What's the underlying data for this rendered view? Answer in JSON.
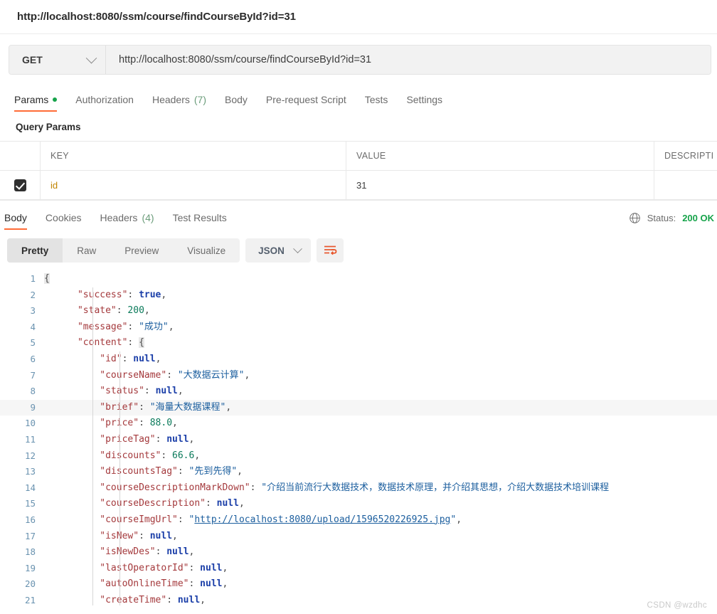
{
  "request": {
    "title": "http://localhost:8080/ssm/course/findCourseById?id=31",
    "method": "GET",
    "url": "http://localhost:8080/ssm/course/findCourseById?id=31",
    "tabs": [
      {
        "label": "Params",
        "badge": "",
        "dot": true,
        "active": true
      },
      {
        "label": "Authorization",
        "badge": "",
        "dot": false,
        "active": false
      },
      {
        "label": "Headers",
        "badge": "(7)",
        "dot": false,
        "active": false
      },
      {
        "label": "Body",
        "badge": "",
        "dot": false,
        "active": false
      },
      {
        "label": "Pre-request Script",
        "badge": "",
        "dot": false,
        "active": false
      },
      {
        "label": "Tests",
        "badge": "",
        "dot": false,
        "active": false
      },
      {
        "label": "Settings",
        "badge": "",
        "dot": false,
        "active": false
      }
    ]
  },
  "params": {
    "section_label": "Query Params",
    "columns": [
      "KEY",
      "VALUE",
      "DESCRIPTI"
    ],
    "rows": [
      {
        "checked": true,
        "key": "id",
        "value": "31",
        "description": ""
      }
    ]
  },
  "response": {
    "tabs": [
      {
        "label": "Body",
        "badge": "",
        "active": true
      },
      {
        "label": "Cookies",
        "badge": "",
        "active": false
      },
      {
        "label": "Headers",
        "badge": "(4)",
        "active": false
      },
      {
        "label": "Test Results",
        "badge": "",
        "active": false
      }
    ],
    "status_label": "Status:",
    "status_code": "200 OK",
    "globe_icon": "globe-icon"
  },
  "viewer": {
    "modes": [
      "Pretty",
      "Raw",
      "Preview",
      "Visualize"
    ],
    "active_mode": "Pretty",
    "format": "JSON",
    "wrap_icon": "wrap-text-icon"
  },
  "code": {
    "lines": [
      {
        "num": "1",
        "indent": 0,
        "highlight": false,
        "tokens": [
          {
            "t": "brc",
            "v": "{"
          }
        ]
      },
      {
        "num": "2",
        "indent": 1,
        "highlight": false,
        "tokens": [
          {
            "t": "k",
            "v": "\"success\""
          },
          {
            "t": "p",
            "v": ": "
          },
          {
            "t": "b",
            "v": "true"
          },
          {
            "t": "p",
            "v": ","
          }
        ]
      },
      {
        "num": "3",
        "indent": 1,
        "highlight": false,
        "tokens": [
          {
            "t": "k",
            "v": "\"state\""
          },
          {
            "t": "p",
            "v": ": "
          },
          {
            "t": "n",
            "v": "200"
          },
          {
            "t": "p",
            "v": ","
          }
        ]
      },
      {
        "num": "4",
        "indent": 1,
        "highlight": false,
        "tokens": [
          {
            "t": "k",
            "v": "\"message\""
          },
          {
            "t": "p",
            "v": ": "
          },
          {
            "t": "s",
            "v": "\"成功\""
          },
          {
            "t": "p",
            "v": ","
          }
        ]
      },
      {
        "num": "5",
        "indent": 1,
        "highlight": false,
        "tokens": [
          {
            "t": "k",
            "v": "\"content\""
          },
          {
            "t": "p",
            "v": ": "
          },
          {
            "t": "brc",
            "v": "{"
          }
        ]
      },
      {
        "num": "6",
        "indent": 2,
        "highlight": false,
        "tokens": [
          {
            "t": "k",
            "v": "\"id\""
          },
          {
            "t": "p",
            "v": ": "
          },
          {
            "t": "b",
            "v": "null"
          },
          {
            "t": "p",
            "v": ","
          }
        ]
      },
      {
        "num": "7",
        "indent": 2,
        "highlight": false,
        "tokens": [
          {
            "t": "k",
            "v": "\"courseName\""
          },
          {
            "t": "p",
            "v": ": "
          },
          {
            "t": "s",
            "v": "\"大数据云计算\""
          },
          {
            "t": "p",
            "v": ","
          }
        ]
      },
      {
        "num": "8",
        "indent": 2,
        "highlight": false,
        "tokens": [
          {
            "t": "k",
            "v": "\"status\""
          },
          {
            "t": "p",
            "v": ": "
          },
          {
            "t": "b",
            "v": "null"
          },
          {
            "t": "p",
            "v": ","
          }
        ]
      },
      {
        "num": "9",
        "indent": 2,
        "highlight": true,
        "tokens": [
          {
            "t": "k",
            "v": "\"brief\""
          },
          {
            "t": "p",
            "v": ": "
          },
          {
            "t": "s",
            "v": "\"海量大数据课程\""
          },
          {
            "t": "p",
            "v": ","
          }
        ]
      },
      {
        "num": "10",
        "indent": 2,
        "highlight": false,
        "tokens": [
          {
            "t": "k",
            "v": "\"price\""
          },
          {
            "t": "p",
            "v": ": "
          },
          {
            "t": "n",
            "v": "88.0"
          },
          {
            "t": "p",
            "v": ","
          }
        ]
      },
      {
        "num": "11",
        "indent": 2,
        "highlight": false,
        "tokens": [
          {
            "t": "k",
            "v": "\"priceTag\""
          },
          {
            "t": "p",
            "v": ": "
          },
          {
            "t": "b",
            "v": "null"
          },
          {
            "t": "p",
            "v": ","
          }
        ]
      },
      {
        "num": "12",
        "indent": 2,
        "highlight": false,
        "tokens": [
          {
            "t": "k",
            "v": "\"discounts\""
          },
          {
            "t": "p",
            "v": ": "
          },
          {
            "t": "n",
            "v": "66.6"
          },
          {
            "t": "p",
            "v": ","
          }
        ]
      },
      {
        "num": "13",
        "indent": 2,
        "highlight": false,
        "tokens": [
          {
            "t": "k",
            "v": "\"discountsTag\""
          },
          {
            "t": "p",
            "v": ": "
          },
          {
            "t": "s",
            "v": "\"先到先得\""
          },
          {
            "t": "p",
            "v": ","
          }
        ]
      },
      {
        "num": "14",
        "indent": 2,
        "highlight": false,
        "tokens": [
          {
            "t": "k",
            "v": "\"courseDescriptionMarkDown\""
          },
          {
            "t": "p",
            "v": ": "
          },
          {
            "t": "s",
            "v": "\"介绍当前流行大数据技术，数据技术原理，并介绍其思想，介绍大数据技术培训课程"
          }
        ]
      },
      {
        "num": "15",
        "indent": 2,
        "highlight": false,
        "tokens": [
          {
            "t": "k",
            "v": "\"courseDescription\""
          },
          {
            "t": "p",
            "v": ": "
          },
          {
            "t": "b",
            "v": "null"
          },
          {
            "t": "p",
            "v": ","
          }
        ]
      },
      {
        "num": "16",
        "indent": 2,
        "highlight": false,
        "tokens": [
          {
            "t": "k",
            "v": "\"courseImgUrl\""
          },
          {
            "t": "p",
            "v": ": "
          },
          {
            "t": "s",
            "v": "\""
          },
          {
            "t": "lnk",
            "v": "http://localhost:8080/upload/1596520226925.jpg"
          },
          {
            "t": "s",
            "v": "\""
          },
          {
            "t": "p",
            "v": ","
          }
        ]
      },
      {
        "num": "17",
        "indent": 2,
        "highlight": false,
        "tokens": [
          {
            "t": "k",
            "v": "\"isNew\""
          },
          {
            "t": "p",
            "v": ": "
          },
          {
            "t": "b",
            "v": "null"
          },
          {
            "t": "p",
            "v": ","
          }
        ]
      },
      {
        "num": "18",
        "indent": 2,
        "highlight": false,
        "tokens": [
          {
            "t": "k",
            "v": "\"isNewDes\""
          },
          {
            "t": "p",
            "v": ": "
          },
          {
            "t": "b",
            "v": "null"
          },
          {
            "t": "p",
            "v": ","
          }
        ]
      },
      {
        "num": "19",
        "indent": 2,
        "highlight": false,
        "tokens": [
          {
            "t": "k",
            "v": "\"lastOperatorId\""
          },
          {
            "t": "p",
            "v": ": "
          },
          {
            "t": "b",
            "v": "null"
          },
          {
            "t": "p",
            "v": ","
          }
        ]
      },
      {
        "num": "20",
        "indent": 2,
        "highlight": false,
        "tokens": [
          {
            "t": "k",
            "v": "\"autoOnlineTime\""
          },
          {
            "t": "p",
            "v": ": "
          },
          {
            "t": "b",
            "v": "null"
          },
          {
            "t": "p",
            "v": ","
          }
        ]
      },
      {
        "num": "21",
        "indent": 2,
        "highlight": false,
        "tokens": [
          {
            "t": "k",
            "v": "\"createTime\""
          },
          {
            "t": "p",
            "v": ": "
          },
          {
            "t": "b",
            "v": "null"
          },
          {
            "t": "p",
            "v": ","
          }
        ]
      }
    ]
  },
  "watermark": "CSDN @wzdhc",
  "colors": {
    "accent": "#ff6c37",
    "green": "#16a34a",
    "key": "#a4393c",
    "string": "#1b5e9e",
    "number": "#0a7a5a",
    "boolean": "#1a3ea8",
    "line_number": "#6a93b0",
    "param_key": "#c18401"
  }
}
